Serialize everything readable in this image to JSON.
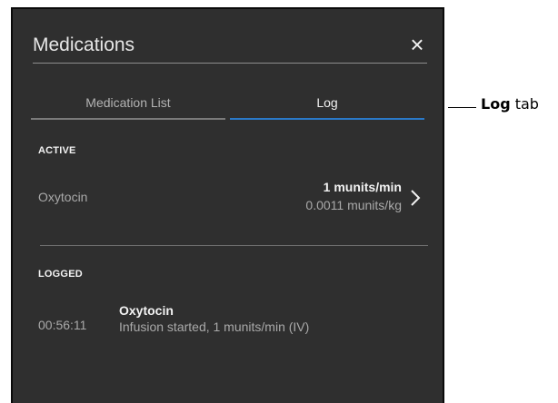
{
  "panel": {
    "title": "Medications",
    "close_glyph": "×",
    "close_icon": "close-icon"
  },
  "tabs": [
    {
      "label": "Medication List",
      "selected": false
    },
    {
      "label": "Log",
      "selected": true
    }
  ],
  "active": {
    "section_label": "ACTIVE",
    "items": [
      {
        "drug": "Oxytocin",
        "rate": "1 munits/min",
        "rate_weight": "0.0011 munits/kg",
        "icon": "chevron-right-icon"
      }
    ]
  },
  "logged": {
    "section_label": "LOGGED",
    "entries": [
      {
        "time": "00:56:11",
        "drug": "Oxytocin",
        "detail": "Infusion started, 1 munits/min (IV)"
      }
    ]
  },
  "callout": {
    "bold": "Log",
    "rest": " tab"
  },
  "colors": {
    "panel_bg": "#2f2f2f",
    "selected_tab_underline": "#2a79c8",
    "unselected_tab_underline": "#7a7a7a",
    "primary_text": "#f2f2f2",
    "secondary_text": "#a9a9a9"
  }
}
